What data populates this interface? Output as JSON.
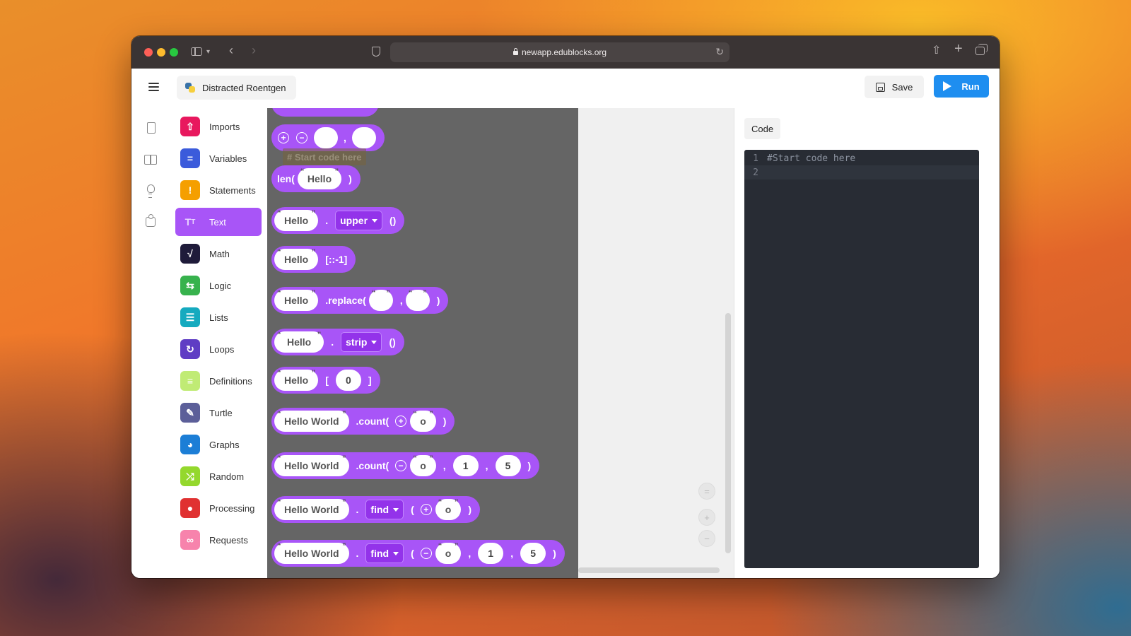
{
  "browser": {
    "url": "newapp.edublocks.org"
  },
  "header": {
    "project_name": "Distracted Roentgen",
    "save_label": "Save",
    "run_label": "Run"
  },
  "categories": [
    {
      "label": "Imports",
      "color": "#e8185e",
      "icon": "upload-icon"
    },
    {
      "label": "Variables",
      "color": "#3b5bdb",
      "icon": "equals-icon"
    },
    {
      "label": "Statements",
      "color": "#f59f00",
      "icon": "exclamation-icon"
    },
    {
      "label": "Text",
      "color": "#a855f7",
      "icon": "text-icon"
    },
    {
      "label": "Math",
      "color": "#1f1b3a",
      "icon": "sqrt-icon"
    },
    {
      "label": "Logic",
      "color": "#37b24d",
      "icon": "swap-icon"
    },
    {
      "label": "Lists",
      "color": "#15aabf",
      "icon": "list-icon"
    },
    {
      "label": "Loops",
      "color": "#5f3dc4",
      "icon": "loop-icon"
    },
    {
      "label": "Definitions",
      "color": "#c0eb75",
      "icon": "document-icon"
    },
    {
      "label": "Turtle",
      "color": "#5c5f99",
      "icon": "pen-icon"
    },
    {
      "label": "Graphs",
      "color": "#1c7ed6",
      "icon": "pie-chart-icon"
    },
    {
      "label": "Random",
      "color": "#94d82d",
      "icon": "shuffle-icon"
    },
    {
      "label": "Processing",
      "color": "#e03131",
      "icon": "palette-icon"
    },
    {
      "label": "Requests",
      "color": "#f783ac",
      "icon": "link-icon"
    }
  ],
  "active_category": "Text",
  "blocks": {
    "ghost": "# Start code here",
    "len_open": "len(",
    "close_paren": ")",
    "hello": "Hello",
    "hello_world": "Hello World",
    "dot": ".",
    "comma": ",",
    "upper": "upper",
    "strip": "strip",
    "find": "find",
    "empty_call": "()",
    "reverse_slice": "[::-1]",
    "replace": ".replace(",
    "open_bracket": "[",
    "close_bracket": "]",
    "index_zero": "0",
    "count": ".count(",
    "o": "o",
    "n1": "1",
    "n5": "5",
    "open_paren": "("
  },
  "code_panel": {
    "tab_label": "Code",
    "lines": [
      {
        "number": "1",
        "text": "#Start code here"
      },
      {
        "number": "2",
        "text": ""
      }
    ]
  }
}
